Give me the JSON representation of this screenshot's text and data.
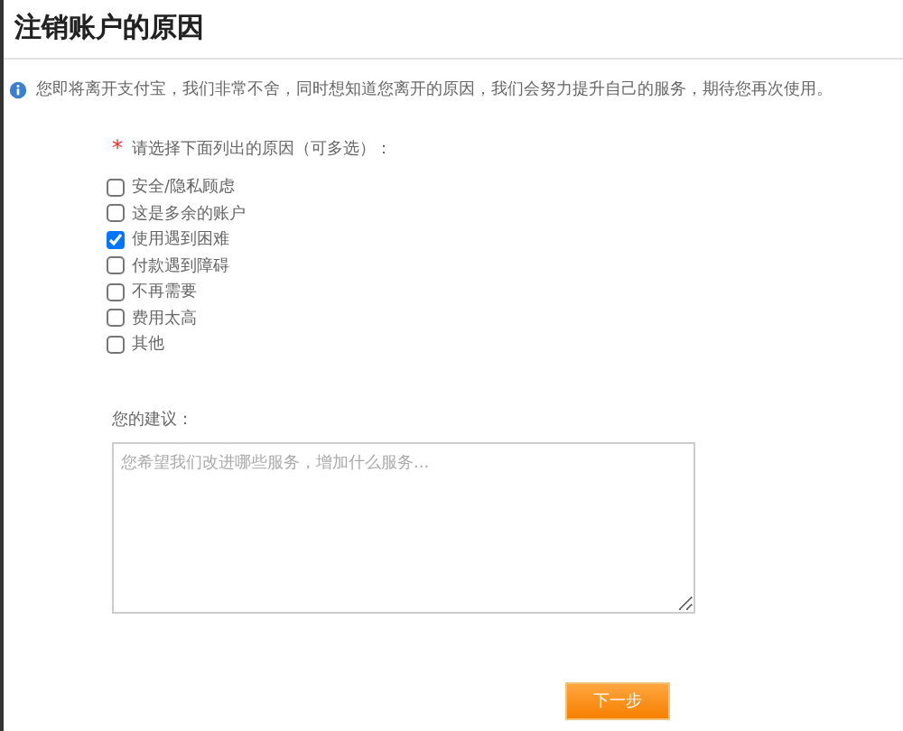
{
  "page": {
    "title": "注销账户的原因"
  },
  "notice": "您即将离开支付宝，我们非常不舍，同时想知道您离开的原因，我们会努力提升自己的服务，期待您再次使用。",
  "reasons": {
    "required_mark": "*",
    "prompt": "请选择下面列出的原因（可多选）：",
    "options": [
      {
        "label": "安全/隐私顾虑",
        "checked": false
      },
      {
        "label": "这是多余的账户",
        "checked": false
      },
      {
        "label": "使用遇到困难",
        "checked": true
      },
      {
        "label": "付款遇到障碍",
        "checked": false
      },
      {
        "label": "不再需要",
        "checked": false
      },
      {
        "label": "费用太高",
        "checked": false
      },
      {
        "label": "其他",
        "checked": false
      }
    ]
  },
  "suggestion": {
    "label": "您的建议：",
    "placeholder": "您希望我们改进哪些服务，增加什么服务..."
  },
  "buttons": [
    {
      "label": "下一步",
      "kind": "primary"
    }
  ]
}
